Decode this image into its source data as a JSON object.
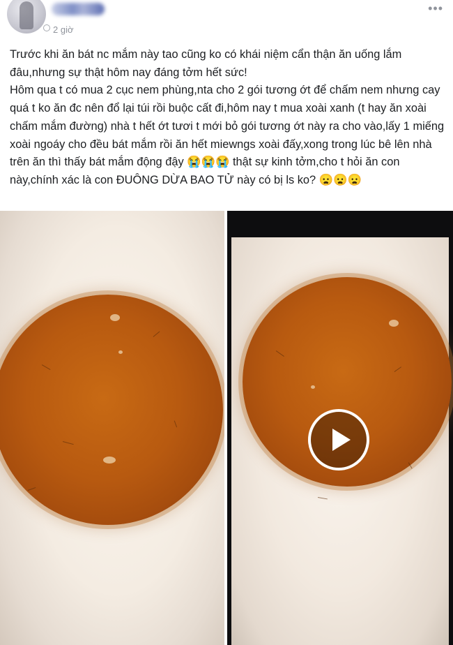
{
  "post": {
    "time": "2 giờ",
    "author_icon": "avatar",
    "more_icon": "more-options-icon",
    "paragraphs": [
      "Trước khi ăn bát nc mắm này tao cũng ko có khái niệm cẩn thận ăn uống lắm đâu,nhưng sự thật hôm nay đáng tởm hết sức!",
      "Hôm qua t có mua 2 cục nem phùng,nta cho 2 gói tương ớt để chấm nem nhưng cay quá t ko ăn đc nên đổ lại túi rồi buộc cất đi,hôm nay t mua xoài xanh (t hay ăn xoài chấm mắm đường) nhà t hết ớt tươi t mới bỏ gói tương ớt này ra cho vào,lấy 1 miếng xoài ngoáy cho đều bát mắm rồi ăn hết miewngs xoài đấy,xong trong lúc bê lên nhà trên ăn thì thấy bát mắm động đậy 😭😭😭 thật sự kinh tởm,cho t hỏi ăn con này,chính xác là con ĐUÔNG DỪA BAO TỬ này có bị ls ko? 😦😦😦"
    ]
  },
  "media": {
    "photo_1": {
      "icon": "photo"
    },
    "photo_2": {
      "icon": "video",
      "play_icon": "play-button-icon"
    }
  }
}
